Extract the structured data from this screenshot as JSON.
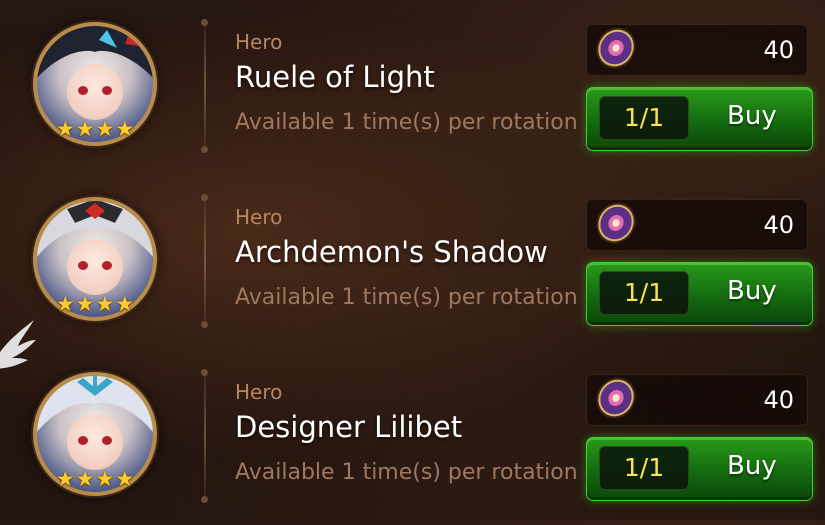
{
  "items": [
    {
      "type": "Hero",
      "name": "Ruele of Light",
      "availability": "Available 1 time(s) per rotation",
      "rarity_stars": 4,
      "cost": "40",
      "currency_icon": "gold-token-icon",
      "remaining": "1/1",
      "buy_label": "Buy",
      "hair_color": "#1f2230",
      "accent_color": "#c52a2a"
    },
    {
      "type": "Hero",
      "name": "Archdemon's Shadow",
      "availability": "Available 1 time(s) per rotation",
      "rarity_stars": 4,
      "cost": "40",
      "currency_icon": "gold-token-icon",
      "remaining": "1/1",
      "buy_label": "Buy",
      "hair_color": "#d8d8de",
      "accent_color": "#cf2a23"
    },
    {
      "type": "Hero",
      "name": "Designer Lilibet",
      "availability": "Available 1 time(s) per rotation",
      "rarity_stars": 4,
      "cost": "40",
      "currency_icon": "gold-token-icon",
      "remaining": "1/1",
      "buy_label": "Buy",
      "hair_color": "#dfe3ee",
      "accent_color": "#3aa7c9"
    }
  ]
}
